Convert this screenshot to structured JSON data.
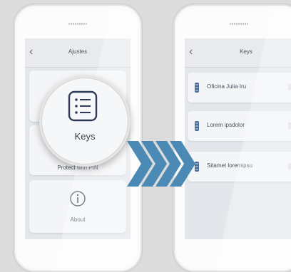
{
  "left_screen": {
    "title": "Ajustes",
    "back_icon": "chevron-left-icon",
    "tiles": [
      {
        "label": "Keys",
        "icon": "list-icon"
      },
      {
        "label": "Protect with PIN"
      },
      {
        "label": "About",
        "icon": "info-icon"
      }
    ]
  },
  "right_screen": {
    "title": "Keys",
    "back_icon": "chevron-left-icon",
    "keys": [
      "Oficina Julia Iru",
      "Lorem ipsdolor",
      "Sitamet loremipsu"
    ]
  },
  "colors": {
    "accent": "#4c6a99",
    "arrow": "#4a8ab4"
  }
}
